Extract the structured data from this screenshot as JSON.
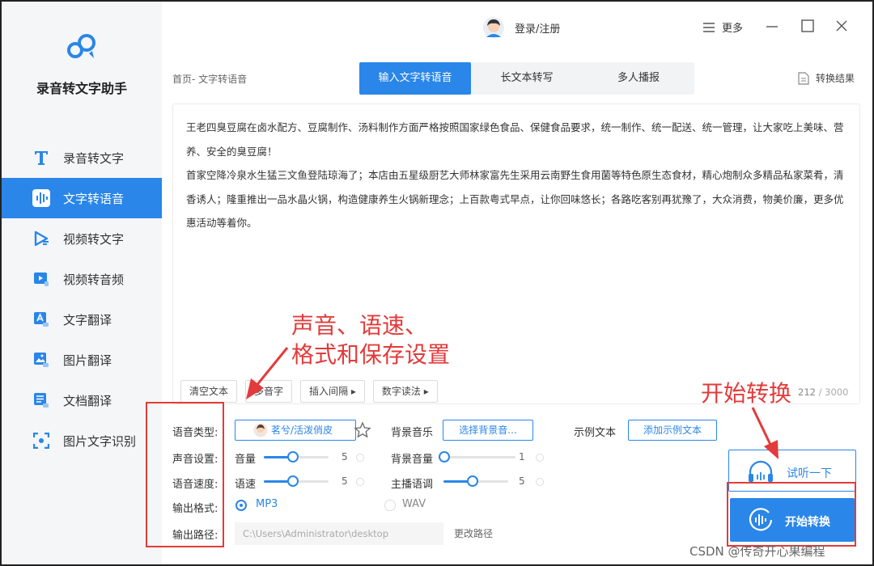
{
  "app": {
    "title": "录音转文字助手"
  },
  "sidebar": {
    "items": [
      {
        "label": "录音转文字",
        "icon": "text-t-icon",
        "active": false
      },
      {
        "label": "文字转语音",
        "icon": "soundwave-icon",
        "active": true
      },
      {
        "label": "视频转文字",
        "icon": "video-text-icon",
        "active": false
      },
      {
        "label": "视频转音频",
        "icon": "video-audio-icon",
        "active": false
      },
      {
        "label": "文字翻译",
        "icon": "text-translate-icon",
        "active": false
      },
      {
        "label": "图片翻译",
        "icon": "image-translate-icon",
        "active": false
      },
      {
        "label": "文档翻译",
        "icon": "doc-translate-icon",
        "active": false
      },
      {
        "label": "图片文字识别",
        "icon": "ocr-scan-icon",
        "active": false
      }
    ]
  },
  "header": {
    "user_label": "登录/注册",
    "more_label": "更多"
  },
  "breadcrumb": "首页- 文字转语音",
  "tabs": [
    {
      "label": "输入文字转语音",
      "active": true
    },
    {
      "label": "长文本转写",
      "active": false
    },
    {
      "label": "多人播报",
      "active": false
    }
  ],
  "result_label": "转换结果",
  "editor": {
    "text": "王老四臭豆腐在卤水配方、豆腐制作、汤料制作方面严格按照国家绿色食品、保健食品要求，统一制作、统一配送、统一管理，让大家吃上美味、营养、安全的臭豆腐！\n首家空降冷泉水生猛三文鱼登陆琼海了；本店由五星级厨艺大师林家富先生采用云南野生食用菌等特色原生态食材，精心炮制众多精品私家菜肴，清香诱人；隆重推出一品水晶火锅，构造健康养生火锅新理念；上百款粤式早点，让你回味悠长；各路吃客别再犹豫了，大众消费，物美价廉，更多优惠活动等着你。",
    "tools": [
      "清空文本",
      "多音字",
      "插入间隔 ▸",
      "数字读法 ▸"
    ],
    "count": "212",
    "max": "/ 3000"
  },
  "settings": {
    "voice_type_label": "语音类型:",
    "voice_name": "茗兮/活泼俏皮",
    "bg_music_label": "背景音乐",
    "bg_music_button": "选择背景音...",
    "sample_label": "示例文本",
    "sample_button": "添加示例文本",
    "sound_label": "声音设置:",
    "speed_label": "语音速度:",
    "format_label": "输出格式:",
    "path_label": "输出路径:",
    "volume": {
      "label": "音量",
      "value": "5",
      "level": 0.45
    },
    "bg_volume": {
      "label": "背景音量",
      "value": "1",
      "level": 0.0
    },
    "speed": {
      "label": "语速",
      "value": "5",
      "level": 0.45
    },
    "pitch": {
      "label": "主播语调",
      "value": "5",
      "level": 0.45
    },
    "formats": [
      {
        "label": "MP3",
        "selected": true
      },
      {
        "label": "WAV",
        "selected": false
      }
    ],
    "path_value": "C:\\Users\\Administrator\\desktop",
    "change_path": "更改路径"
  },
  "actions": {
    "listen_label": "试听一下",
    "start_label": "开始转换"
  },
  "annotations": {
    "settings_note": [
      "声音、语速、",
      "格式和保存设置"
    ],
    "start_note": "开始转换"
  },
  "watermark": "CSDN @传奇开心果编程",
  "colors": {
    "accent": "#2a86e8",
    "annotation": "#e23b3b",
    "sidebar_bg": "#f5f6f8"
  }
}
